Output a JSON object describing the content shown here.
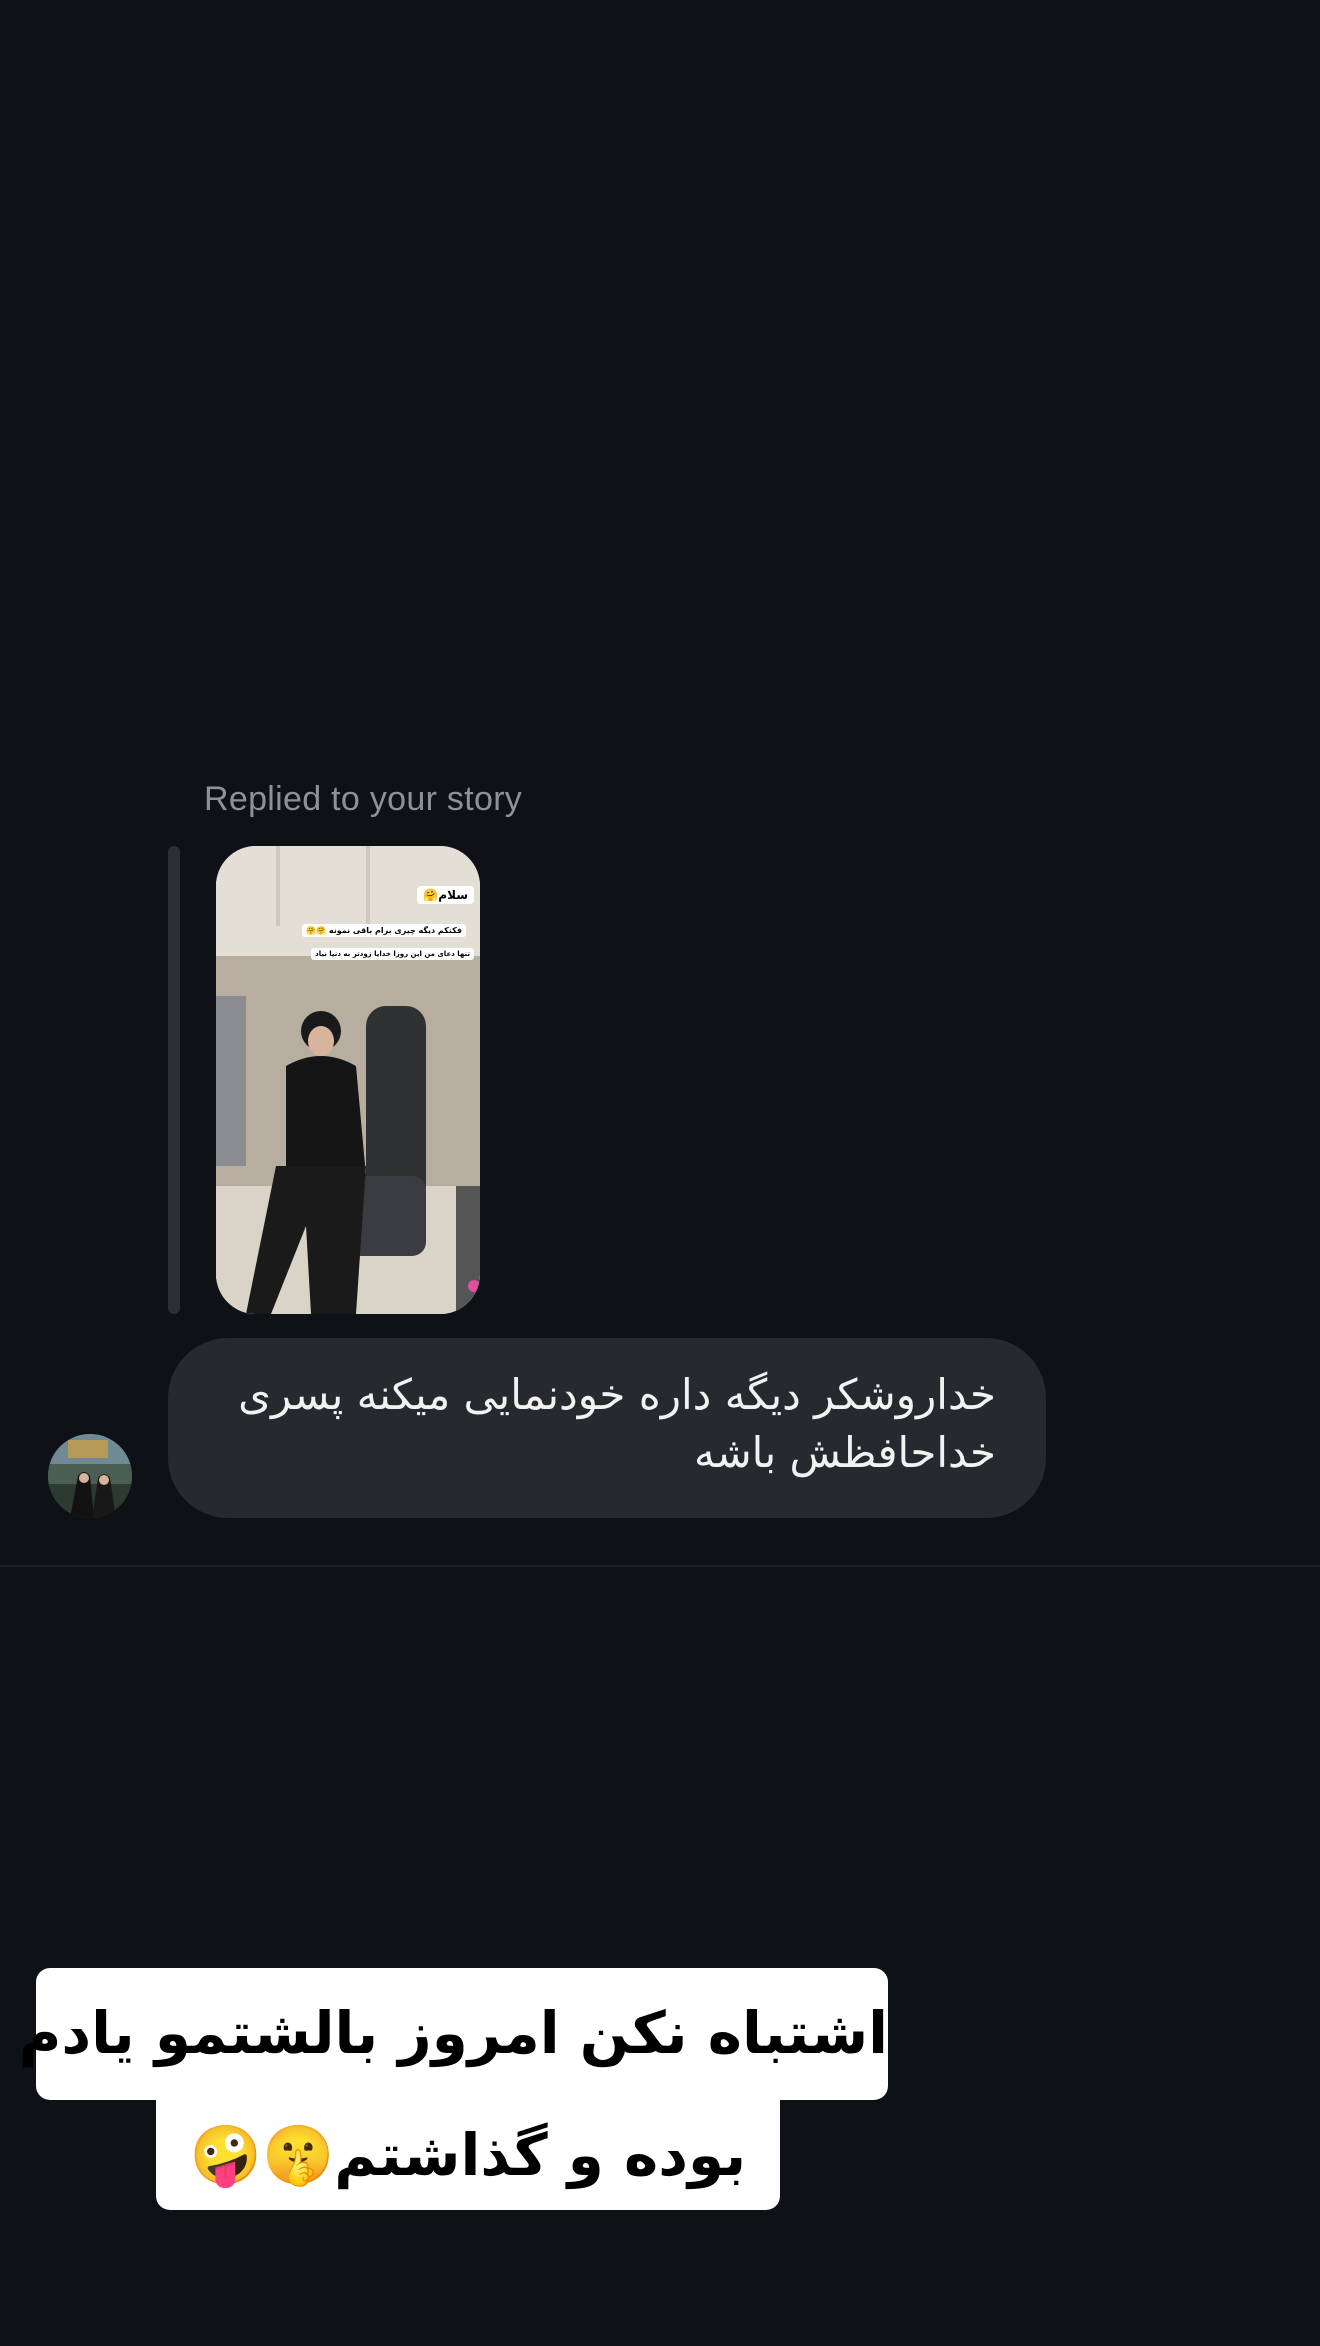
{
  "thread": {
    "reply_label": "Replied to your story",
    "story": {
      "sticker_1": "سلام🤗",
      "sticker_2": "فکنکم دیگه چیزی برام باقی نمونه 🤗🤗",
      "sticker_3": "تنها دعای من این روزا خدایا زودتر به دنیا نیاد"
    },
    "message_text": "خداروشکر دیگه داره خودنمایی میکنه پسری\nخداحافظش باشه",
    "avatar_icon": "profile-avatar"
  },
  "caption": {
    "line_1": "اشتباه نکن امروز بالشتمو یادم",
    "line_2": "بوده و گذاشتم🤫🤪"
  },
  "colors": {
    "background": "#0e1115",
    "bubble": "#26292e",
    "reply_label": "#8e9197",
    "caption_bg": "#ffffff"
  }
}
